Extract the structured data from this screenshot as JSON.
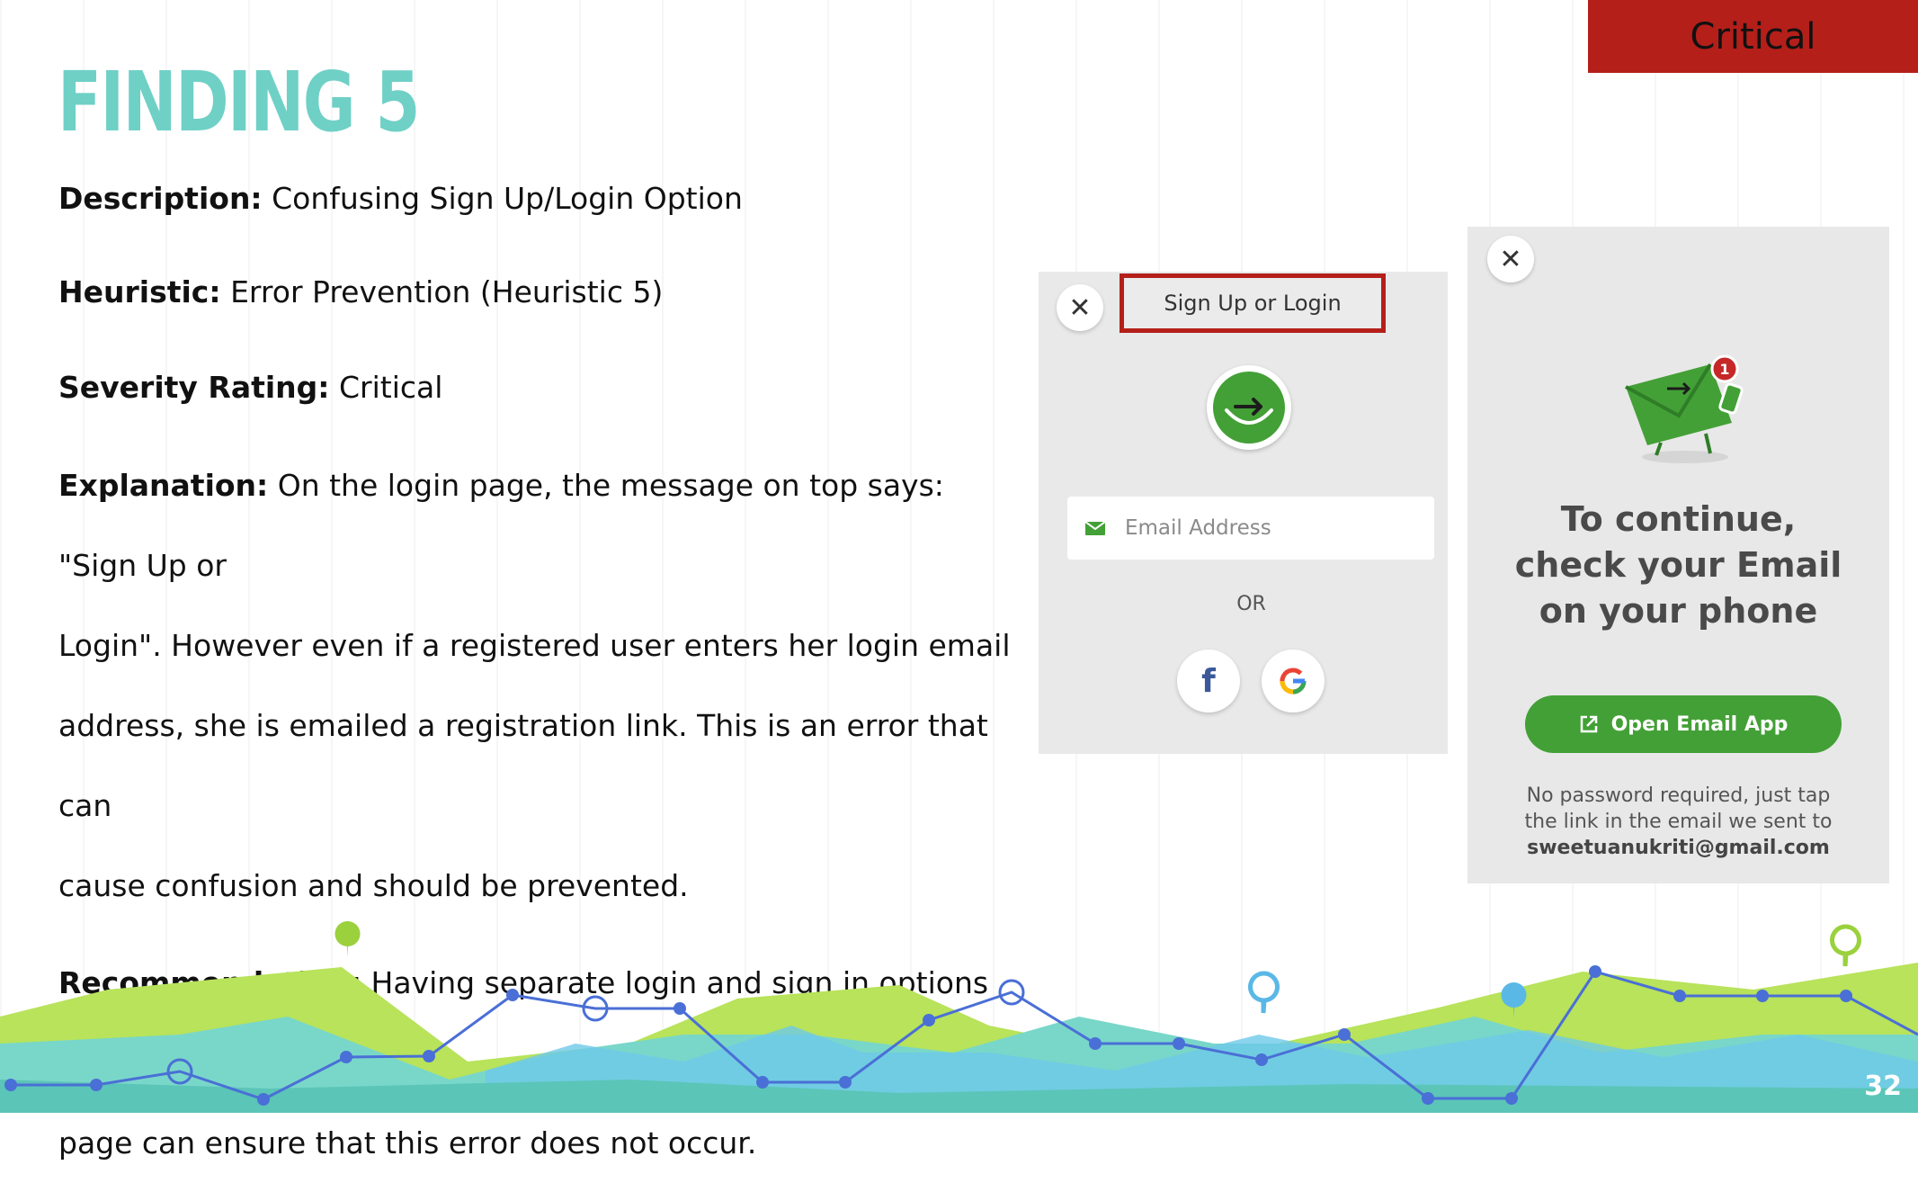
{
  "badge": "Critical",
  "title": "FINDING 5",
  "rows": {
    "description": {
      "label": "Description:",
      "value": " Confusing Sign Up/Login Option"
    },
    "heuristic": {
      "label": "Heuristic:",
      "value": " Error Prevention (Heuristic 5)"
    },
    "severity": {
      "label": "Severity Rating:",
      "value": " Critical"
    },
    "explanation": {
      "label": "Explanation:",
      "line1": " On the login page, the message on top says: \"Sign Up or",
      "line2": "Login\". However even if a registered user enters her login email",
      "line3": "address, she is emailed a registration link. This is an error that can",
      "line4": "cause confusion and should be prevented."
    },
    "recommendation": {
      "label": "Recommendation:",
      "line1": " Having separate login and sign in options on the",
      "line2": "page can ensure that this error does not occur."
    }
  },
  "login_screen": {
    "close_glyph": "✕",
    "header": "Sign Up or Login",
    "email_placeholder": "Email Address",
    "or_text": "OR",
    "facebook_glyph": "f",
    "google_glyph": "G",
    "accent_color": "#43a036",
    "highlight_color": "#b41f1a"
  },
  "email_screen": {
    "close_glyph": "✕",
    "notification_count": "1",
    "heading_line1": "To continue,",
    "heading_line2": "check your Email",
    "heading_line3": "on your phone",
    "button_label": "Open Email App",
    "note_line1": "No password required, just tap",
    "note_line2": "the link in the email we sent to",
    "email": "sweetuanukriti@gmail.com"
  },
  "page_number": "32"
}
